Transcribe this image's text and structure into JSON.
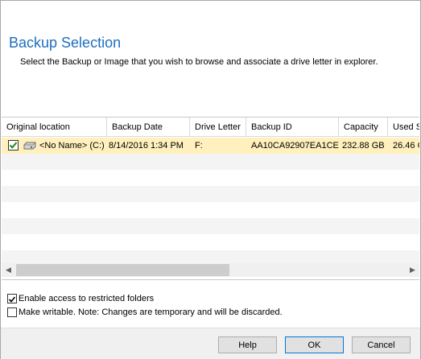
{
  "dialog": {
    "title": "Backup Selection",
    "subtitle": "Select the Backup or Image that you wish to browse and associate a drive letter in explorer."
  },
  "grid": {
    "columns": [
      {
        "label": "Original location"
      },
      {
        "label": "Backup Date"
      },
      {
        "label": "Drive Letter"
      },
      {
        "label": "Backup ID"
      },
      {
        "label": "Capacity"
      },
      {
        "label": "Used S"
      }
    ],
    "rows": [
      {
        "checked": true,
        "icon": "drive-icon",
        "original_location": "<No Name> (C:)",
        "backup_date": "8/14/2016 1:34 PM",
        "drive_letter": "F:",
        "backup_id": "AA10CA92907EA1CE",
        "capacity": "232.88 GB",
        "used": "26.46 G"
      }
    ]
  },
  "options": {
    "restricted_label": "Enable access to restricted folders",
    "restricted_checked": true,
    "writable_label": "Make writable. Note: Changes are temporary and will be discarded.",
    "writable_checked": false
  },
  "buttons": {
    "help": "Help",
    "ok": "OK",
    "cancel": "Cancel"
  },
  "colors": {
    "title": "#1e6fbf",
    "selected_row": "#fff0bd",
    "checkmark": "#1a8c1a"
  }
}
